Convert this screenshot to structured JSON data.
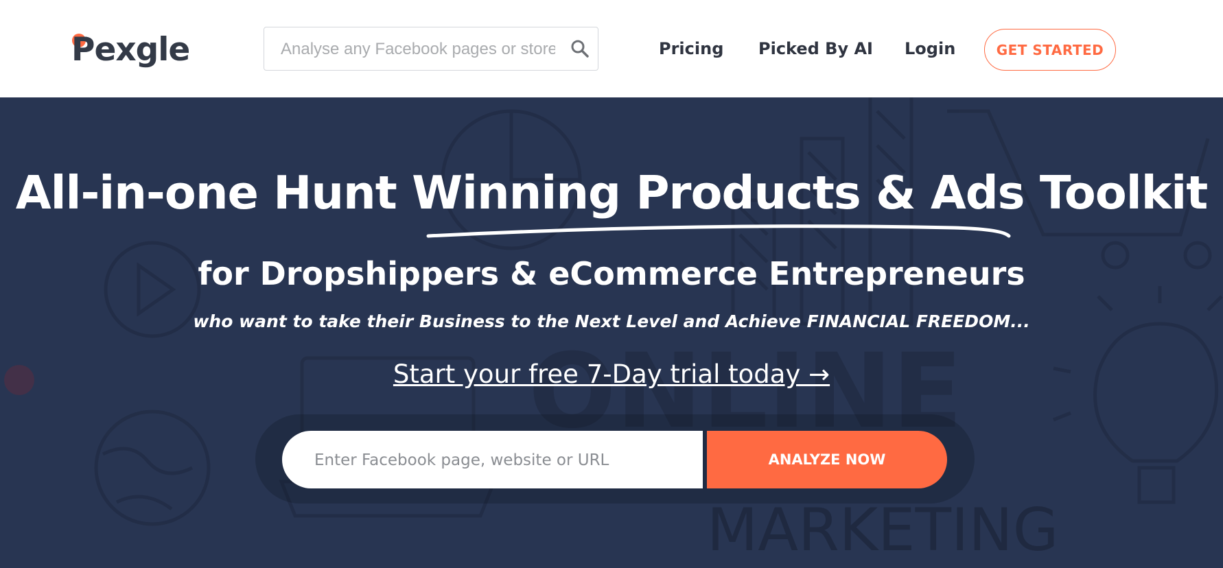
{
  "brand": {
    "name": "Pexgle",
    "accent_color": "#ff6a42",
    "dark_text_color": "#2f3440",
    "hero_background": "#283552"
  },
  "header": {
    "logo_text": "Pexgle",
    "search_placeholder": "Analyse any Facebook pages or stores",
    "search_icon": "search-icon",
    "nav": {
      "pricing": "Pricing",
      "picked_by_ai": "Picked By AI",
      "login": "Login"
    },
    "cta_label": "GET STARTED"
  },
  "hero": {
    "title_part1": "All-in-one Hunt ",
    "title_part2": "Winning Products & Ads",
    "title_part3": " Toolkit",
    "subtitle": "for Dropshippers & eCommerce Entrepreneurs",
    "tagline": "who want to take their Business to the Next Level and Achieve FINANCIAL FREEDOM...",
    "trial_link": "Start your free 7-Day trial today →",
    "input_placeholder": "Enter Facebook page, website or URL",
    "analyze_label": "ANALYZE NOW",
    "background_words": [
      "ONLINE",
      "MARKETING"
    ]
  }
}
